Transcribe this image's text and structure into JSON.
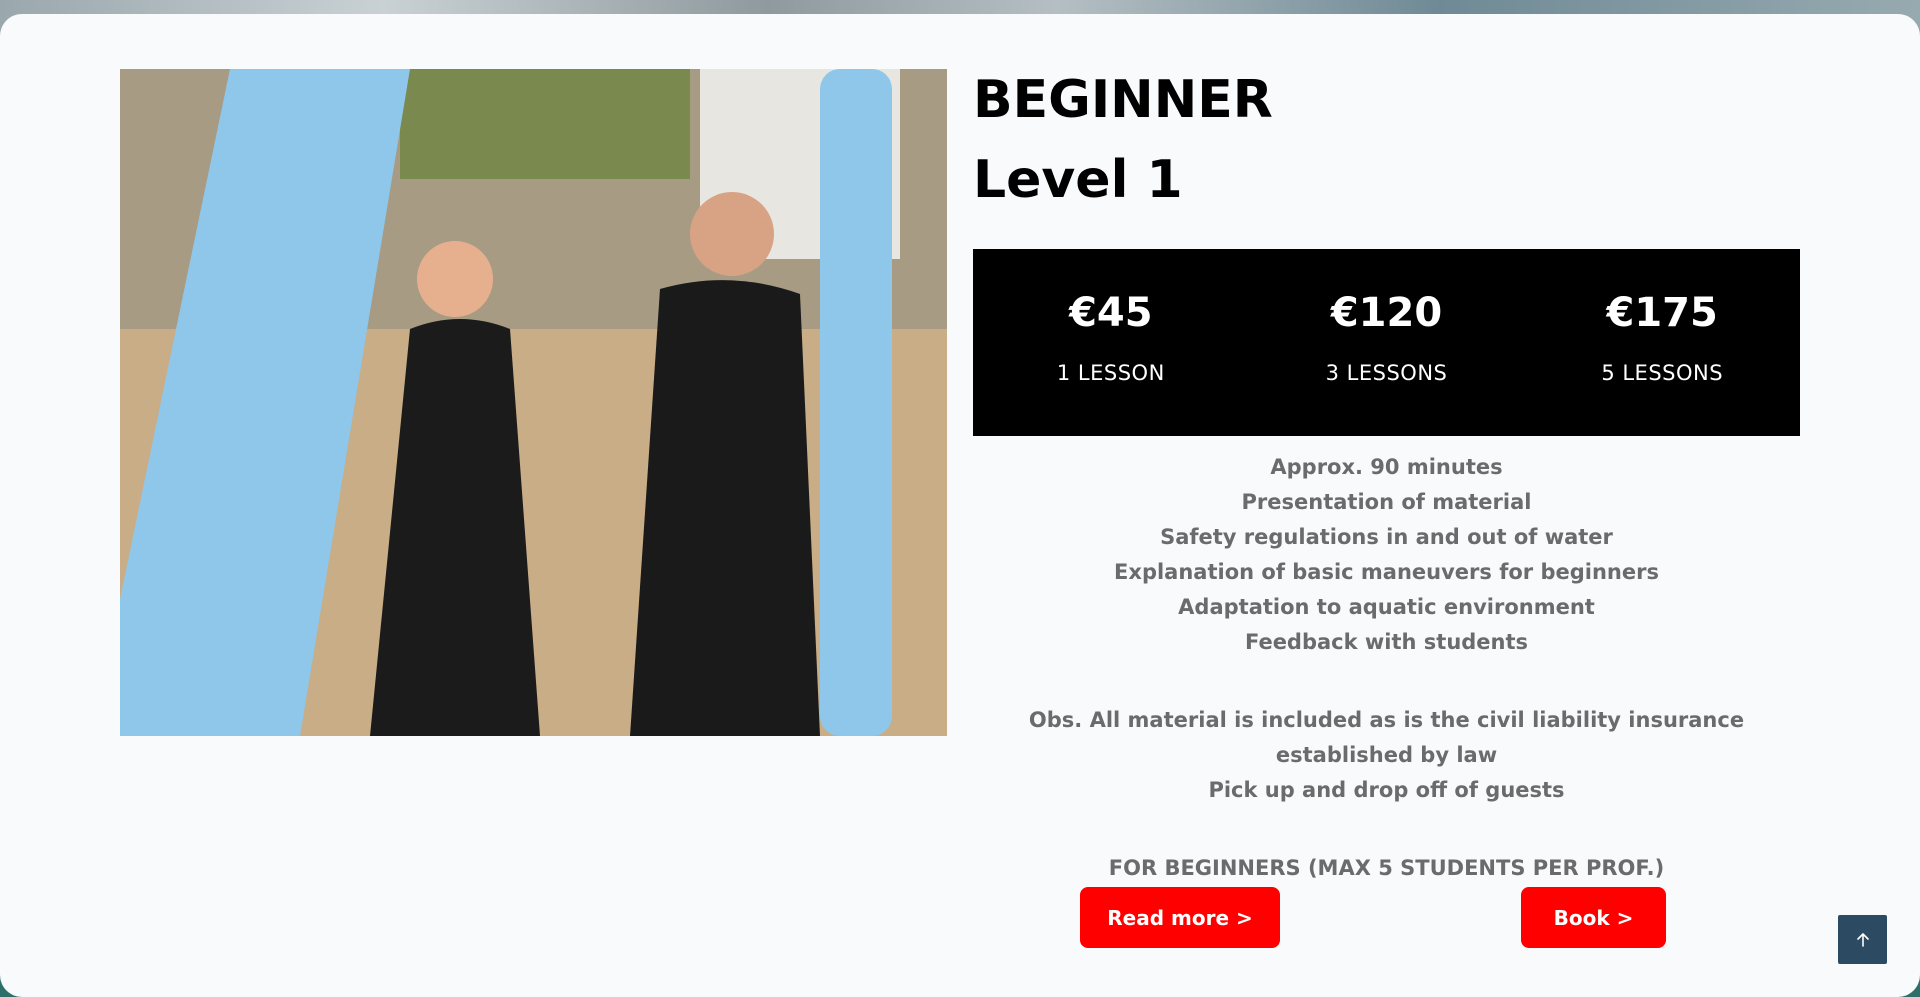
{
  "level": {
    "title": "BEGINNER",
    "subtitle": "Level 1"
  },
  "prices": [
    {
      "amount": "€45",
      "label": "1 LESSON"
    },
    {
      "amount": "€120",
      "label": "3 LESSONS"
    },
    {
      "amount": "€175",
      "label": "5 LESSONS"
    }
  ],
  "details": {
    "items": [
      "Approx. 90 minutes",
      "Presentation of material",
      "Safety regulations in and out of water",
      "Explanation of basic maneuvers for beginners",
      "Adaptation to aquatic environment",
      "Feedback with students"
    ],
    "obs_1": "Obs. All material is included as is the civil liability insurance established by law",
    "obs_2": "Pick up and drop off of guests",
    "group_note": "FOR BEGINNERS (MAX 5 STUDENTS PER PROF.)"
  },
  "buttons": {
    "read_more": "Read more >",
    "book": "Book >"
  },
  "icons": {
    "back_to_top": "arrow-up-icon"
  },
  "colors": {
    "accent": "#ff0000",
    "price_bg": "#000000",
    "back_to_top_bg": "#2d4a63",
    "detail_text": "#6b6b6b"
  }
}
